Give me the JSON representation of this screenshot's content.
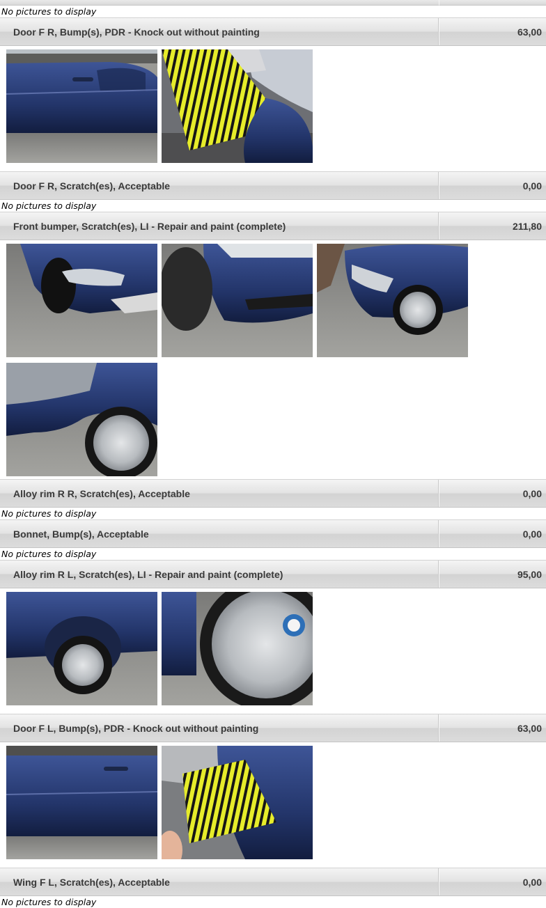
{
  "no_pictures_text": "No pictures to display",
  "items": [
    {
      "desc": "Door F R, Bump(s), PDR - Knock out without painting",
      "price": "63,00"
    },
    {
      "desc": "Door F R, Scratch(es), Acceptable",
      "price": "0,00"
    },
    {
      "desc": "Front bumper, Scratch(es), LI - Repair and paint (complete)",
      "price": "211,80"
    },
    {
      "desc": "Alloy rim R R, Scratch(es), Acceptable",
      "price": "0,00"
    },
    {
      "desc": "Bonnet, Bump(s), Acceptable",
      "price": "0,00"
    },
    {
      "desc": "Alloy rim R L, Scratch(es), LI - Repair and paint (complete)",
      "price": "95,00"
    },
    {
      "desc": "Door F L, Bump(s), PDR - Knock out without painting",
      "price": "63,00"
    },
    {
      "desc": "Wing F L, Scratch(es), Acceptable",
      "price": "0,00"
    }
  ],
  "colors": {
    "car_paint": "#23356a",
    "car_paint_light": "#3e5597",
    "asphalt": "#8d8d8a",
    "gauge_yellow": "#e6ec2a"
  }
}
